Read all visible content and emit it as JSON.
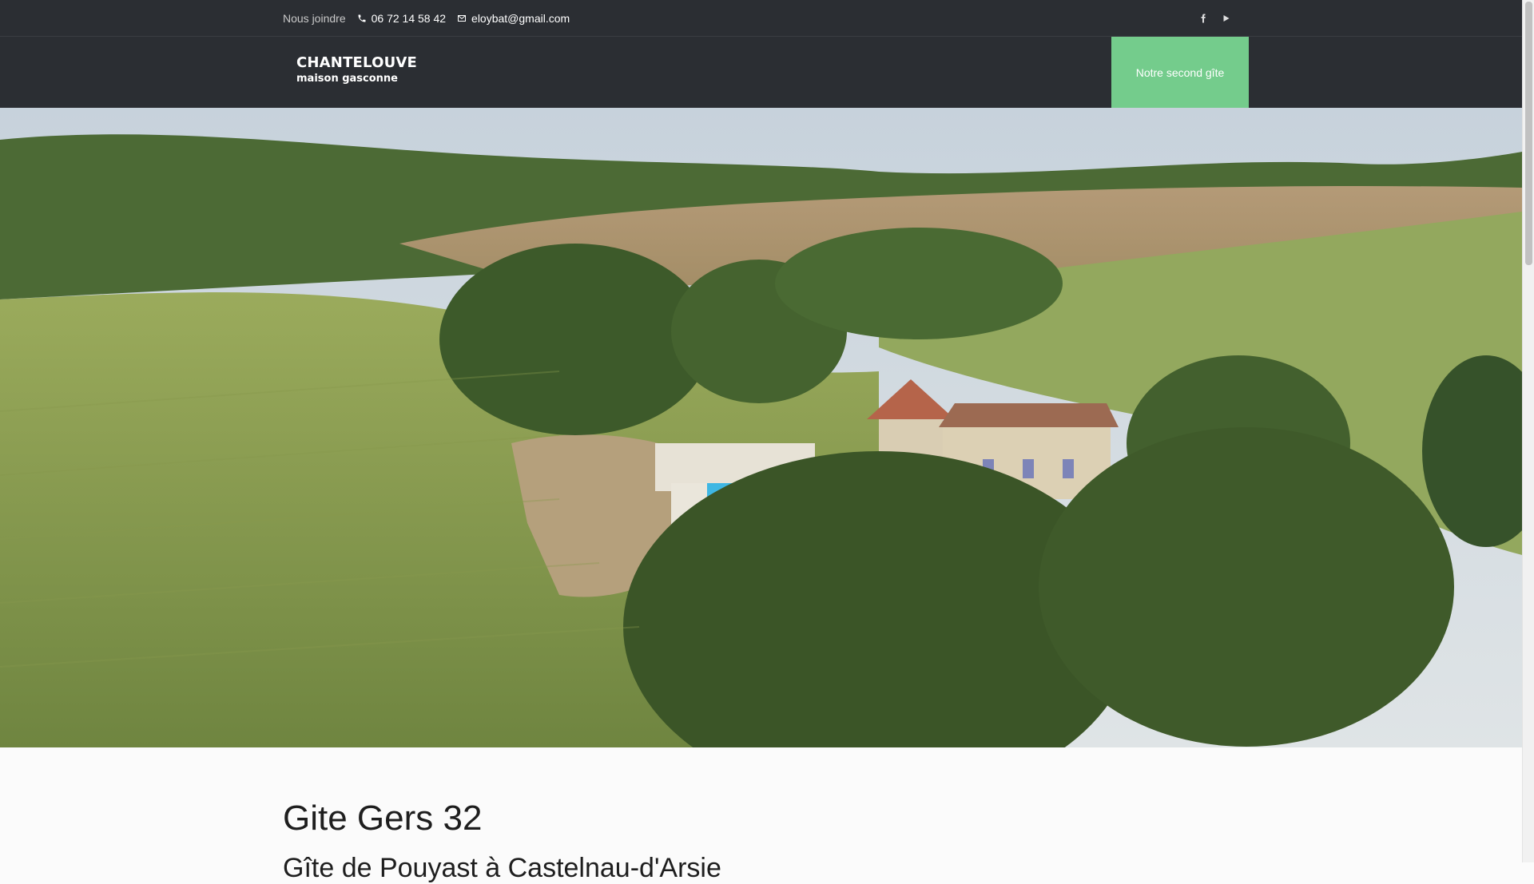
{
  "topbar": {
    "contact_label": "Nous joindre",
    "phone": "06 72 14 58 42",
    "email": "eloybat@gmail.com",
    "social": [
      "facebook-icon",
      "youtube-icon"
    ]
  },
  "header": {
    "logo_title": "CHANTELOUVE",
    "logo_subtitle": "maison gasconne",
    "cta_label": "Notre second gîte"
  },
  "hero": {
    "image": "Aerial view of countryside with house and pool"
  },
  "content": {
    "heading": "Gite Gers 32",
    "subheading": "Gîte de Pouyast à Castelnau-d'Arsie"
  },
  "colors": {
    "topbar_bg": "#2b2e33",
    "cta_bg": "#74cc8c"
  }
}
